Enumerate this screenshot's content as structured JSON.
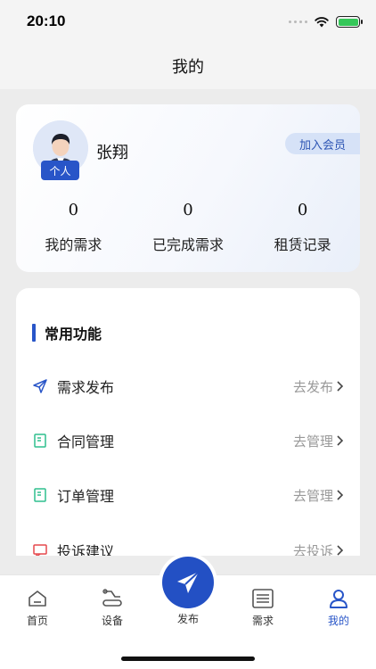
{
  "status_bar": {
    "time": "20:10"
  },
  "nav": {
    "title": "我的"
  },
  "profile": {
    "name": "张翔",
    "badge": "个人",
    "join_label": "加入会员",
    "stats": [
      {
        "value": "0",
        "label": "我的需求"
      },
      {
        "value": "0",
        "label": "已完成需求"
      },
      {
        "value": "0",
        "label": "租赁记录"
      }
    ]
  },
  "functions": {
    "title": "常用功能",
    "items": [
      {
        "label": "需求发布",
        "action": "去发布",
        "icon": "send-icon"
      },
      {
        "label": "合同管理",
        "action": "去管理",
        "icon": "contract-icon"
      },
      {
        "label": "订单管理",
        "action": "去管理",
        "icon": "order-icon"
      },
      {
        "label": "投诉建议",
        "action": "去投诉",
        "icon": "complaint-icon"
      }
    ]
  },
  "tabs": [
    {
      "label": "首页",
      "icon": "home-icon",
      "active": false
    },
    {
      "label": "设备",
      "icon": "equipment-icon",
      "active": false
    },
    {
      "label": "发布",
      "icon": "paper-plane-icon",
      "active": false
    },
    {
      "label": "需求",
      "icon": "list-icon",
      "active": false
    },
    {
      "label": "我的",
      "icon": "user-icon",
      "active": true
    }
  ],
  "colors": {
    "accent": "#2855c8",
    "background": "#ececec",
    "join_bg": "#d6e2f7"
  }
}
